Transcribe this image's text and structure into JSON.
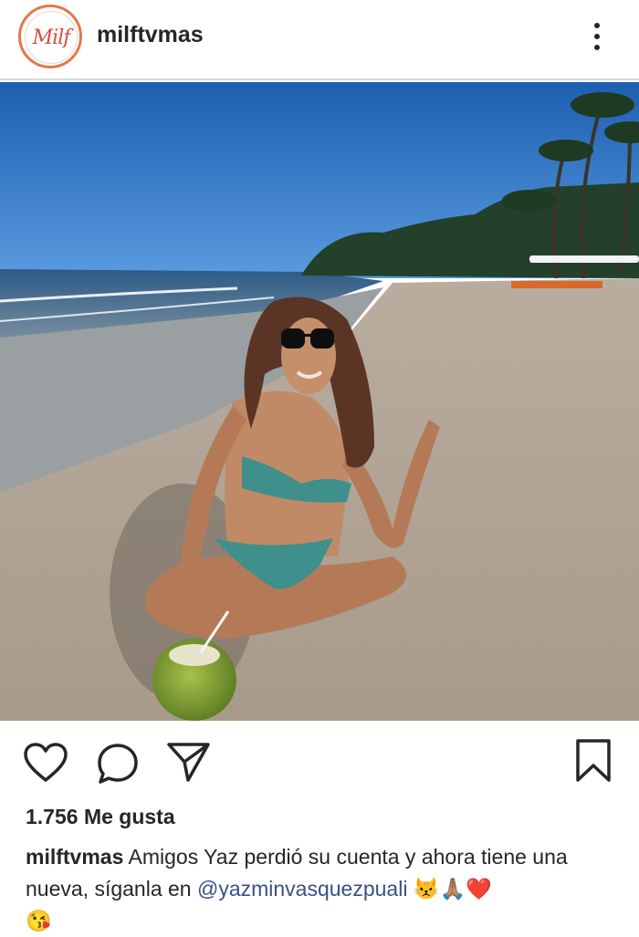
{
  "header": {
    "avatar_text": "Milf",
    "username": "milftvmas",
    "more_icon": "more-vertical-icon"
  },
  "post": {
    "image_subject": "woman in bikini sitting on beach with coconut",
    "actions": {
      "like_icon": "heart-icon",
      "comment_icon": "comment-icon",
      "share_icon": "send-icon",
      "save_icon": "bookmark-icon"
    },
    "likes": "1.756 Me gusta",
    "caption": {
      "username": "milftvmas",
      "text_before": "Amigos Yaz perdió su cuenta y ahora tiene una nueva, síganla en",
      "mention": "@yazminvasquezpuali",
      "emojis_line1": "😾🙏🏽❤️",
      "emojis_line2": "😘"
    }
  },
  "colors": {
    "mention": "#385185",
    "text": "#262626",
    "divider": "#dbdbdb"
  }
}
